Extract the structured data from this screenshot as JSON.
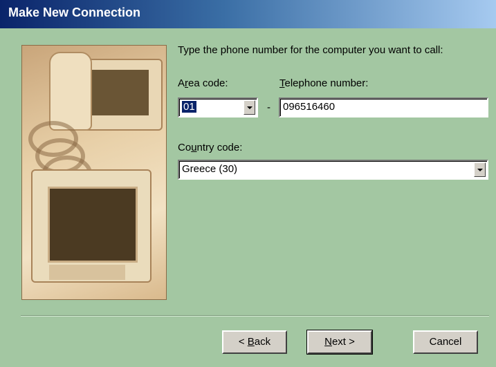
{
  "window": {
    "title": "Make New Connection"
  },
  "instruction": "Type the phone number for the computer you want to call:",
  "area_code": {
    "label_pre": "A",
    "label_accel": "r",
    "label_post": "ea code:",
    "value": "01"
  },
  "dash": "-",
  "telephone": {
    "label_accel": "T",
    "label_post": "elephone number:",
    "value": "096516460"
  },
  "country": {
    "label_pre": "Co",
    "label_accel": "u",
    "label_post": "ntry code:",
    "value": "Greece (30)"
  },
  "buttons": {
    "back_pre": "< ",
    "back_accel": "B",
    "back_post": "ack",
    "next_accel": "N",
    "next_post": "ext >",
    "cancel": "Cancel"
  }
}
